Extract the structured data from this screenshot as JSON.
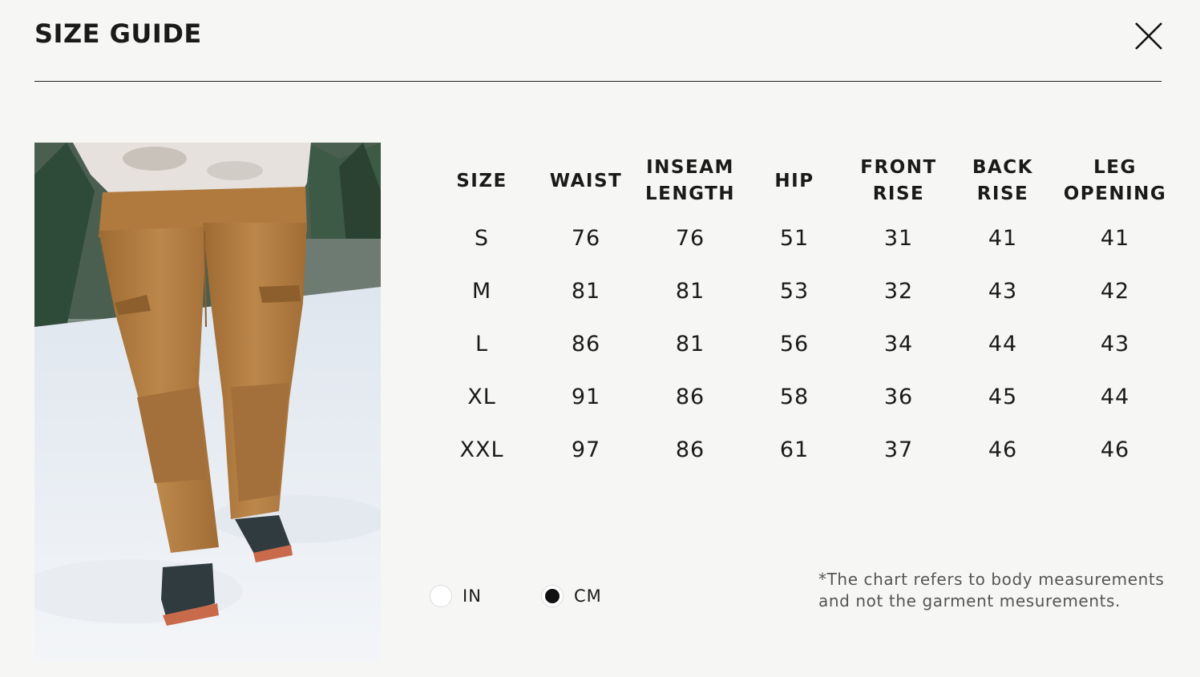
{
  "header": {
    "title": "SIZE GUIDE",
    "close_icon": "close-icon"
  },
  "photo": {
    "subject": "model-wearing-brown-pants-in-snow"
  },
  "size_table": {
    "headers": [
      [
        "SIZE"
      ],
      [
        "WAIST"
      ],
      [
        "INSEAM",
        "LENGTH"
      ],
      [
        "HIP"
      ],
      [
        "FRONT",
        "RISE"
      ],
      [
        "BACK",
        "RISE"
      ],
      [
        "LEG",
        "OPENING"
      ]
    ],
    "rows": [
      [
        "S",
        "76",
        "76",
        "51",
        "31",
        "41",
        "41"
      ],
      [
        "M",
        "81",
        "81",
        "53",
        "32",
        "43",
        "42"
      ],
      [
        "L",
        "86",
        "81",
        "56",
        "34",
        "44",
        "43"
      ],
      [
        "XL",
        "91",
        "86",
        "58",
        "36",
        "45",
        "44"
      ],
      [
        "XXL",
        "97",
        "86",
        "61",
        "37",
        "46",
        "46"
      ]
    ]
  },
  "units": {
    "options": [
      {
        "label": "IN",
        "selected": false
      },
      {
        "label": "CM",
        "selected": true
      }
    ]
  },
  "note": {
    "line1": "*The chart refers to body measurements",
    "line2": "and not the garment mesurements."
  },
  "colors": {
    "background": "#f6f6f4",
    "text": "#1a1a1a",
    "pants": "#b98345"
  }
}
